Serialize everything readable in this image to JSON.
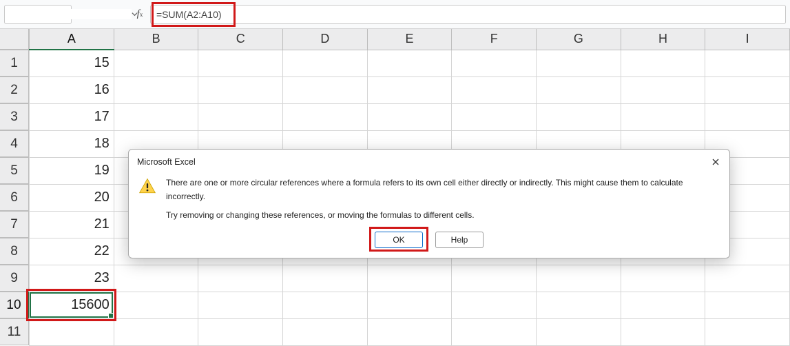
{
  "name_box": {
    "value": ""
  },
  "formula_bar": {
    "value": "=SUM(A2:A10)"
  },
  "columns": [
    "A",
    "B",
    "C",
    "D",
    "E",
    "F",
    "G",
    "H",
    "I"
  ],
  "rows": [
    "1",
    "2",
    "3",
    "4",
    "5",
    "6",
    "7",
    "8",
    "9",
    "10",
    "11"
  ],
  "active_col_index": 0,
  "active_row_index": 9,
  "cells": {
    "A1": "15",
    "A2": "16",
    "A3": "17",
    "A4": "18",
    "A5": "19",
    "A6": "20",
    "A7": "21",
    "A8": "22",
    "A9": "23",
    "A10": "15600"
  },
  "dialog": {
    "title": "Microsoft Excel",
    "line1": "There are one or more circular references where a formula refers to its own cell either directly or indirectly. This might cause them to calculate incorrectly.",
    "line2": "Try removing or changing these references, or moving the formulas to different cells.",
    "ok": "OK",
    "help": "Help"
  }
}
